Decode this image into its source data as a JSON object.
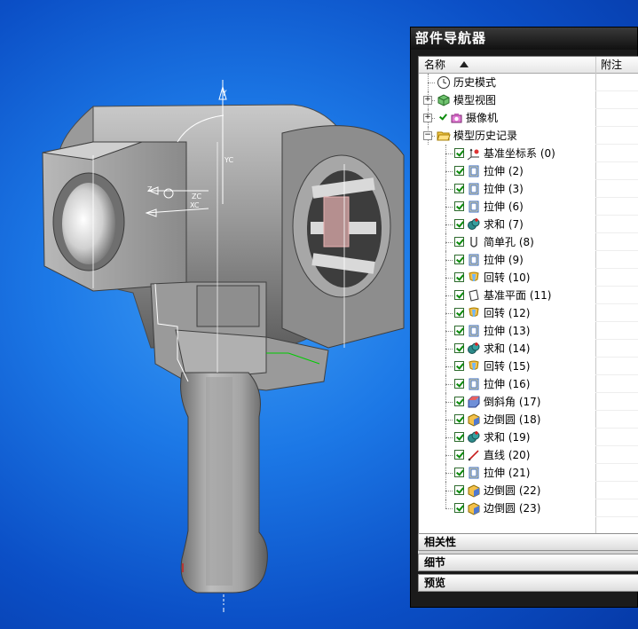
{
  "navigator": {
    "title": "部件导航器",
    "columns": {
      "name": "名称",
      "note": "附注"
    },
    "sections": [
      "相关性",
      "细节",
      "预览"
    ],
    "tree": [
      {
        "label": "历史模式",
        "icon": "clock-icon",
        "level": 0,
        "expander": "",
        "checked": false,
        "visible_check": false
      },
      {
        "label": "模型视图",
        "icon": "model-view-icon",
        "level": 0,
        "expander": "+",
        "checked": false,
        "visible_check": false
      },
      {
        "label": "摄像机",
        "icon": "camera-icon",
        "level": 0,
        "expander": "+",
        "checked": false,
        "visible_check": true
      },
      {
        "label": "模型历史记录",
        "icon": "folder-open-icon",
        "level": 0,
        "expander": "-",
        "checked": false,
        "visible_check": false
      },
      {
        "label": "基准坐标系 (0)",
        "icon": "datum-csys-icon",
        "level": 1,
        "checked": true
      },
      {
        "label": "拉伸 (2)",
        "icon": "extrude-icon",
        "level": 1,
        "checked": true
      },
      {
        "label": "拉伸 (3)",
        "icon": "extrude-icon",
        "level": 1,
        "checked": true
      },
      {
        "label": "拉伸 (6)",
        "icon": "extrude-icon",
        "level": 1,
        "checked": true
      },
      {
        "label": "求和 (7)",
        "icon": "unite-icon",
        "level": 1,
        "checked": true
      },
      {
        "label": "简单孔 (8)",
        "icon": "hole-icon",
        "level": 1,
        "checked": true
      },
      {
        "label": "拉伸 (9)",
        "icon": "extrude-icon",
        "level": 1,
        "checked": true
      },
      {
        "label": "回转 (10)",
        "icon": "revolve-icon",
        "level": 1,
        "checked": true
      },
      {
        "label": "基准平面 (11)",
        "icon": "datum-plane-icon",
        "level": 1,
        "checked": true
      },
      {
        "label": "回转 (12)",
        "icon": "revolve-icon",
        "level": 1,
        "checked": true
      },
      {
        "label": "拉伸 (13)",
        "icon": "extrude-icon",
        "level": 1,
        "checked": true
      },
      {
        "label": "求和 (14)",
        "icon": "unite-icon",
        "level": 1,
        "checked": true
      },
      {
        "label": "回转 (15)",
        "icon": "revolve-icon",
        "level": 1,
        "checked": true
      },
      {
        "label": "拉伸 (16)",
        "icon": "extrude-icon",
        "level": 1,
        "checked": true
      },
      {
        "label": "倒斜角 (17)",
        "icon": "chamfer-icon",
        "level": 1,
        "checked": true
      },
      {
        "label": "边倒圆 (18)",
        "icon": "edge-blend-icon",
        "level": 1,
        "checked": true
      },
      {
        "label": "求和 (19)",
        "icon": "unite-icon",
        "level": 1,
        "checked": true
      },
      {
        "label": "直线 (20)",
        "icon": "line-icon",
        "level": 1,
        "checked": true
      },
      {
        "label": "拉伸 (21)",
        "icon": "extrude-icon",
        "level": 1,
        "checked": true
      },
      {
        "label": "边倒圆 (22)",
        "icon": "edge-blend-icon",
        "level": 1,
        "checked": true
      },
      {
        "label": "边倒圆 (23)",
        "icon": "edge-blend-icon",
        "level": 1,
        "checked": true
      }
    ]
  },
  "viewport": {
    "axis_labels": {
      "y": "Y",
      "yc": "YC",
      "z": "Z",
      "zc": "ZC",
      "xc": "XC"
    },
    "colors": {
      "background_center": "#3d9cf5",
      "background_edge": "#063aa8",
      "part": "#8c8c8c"
    }
  }
}
